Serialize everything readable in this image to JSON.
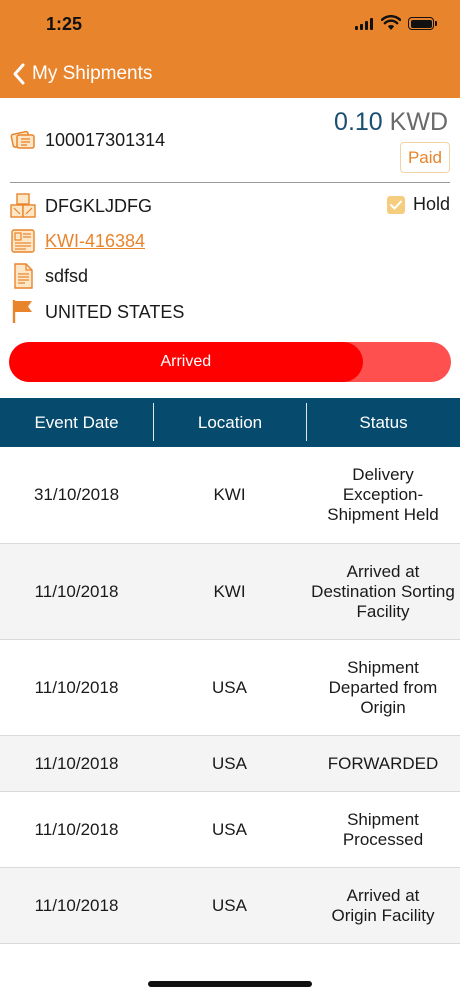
{
  "status_bar": {
    "time": "1:25"
  },
  "nav": {
    "back_label": "My Shipments"
  },
  "shipment": {
    "awb": "100017301314",
    "amount_value": "0.10",
    "amount_currency": "KWD",
    "payment_status": "Paid",
    "reference": "DFGKLJDFG",
    "hold_label": "Hold",
    "hold_checked": true,
    "invoice_link": "KWI-416384",
    "description": "sdfsd",
    "country": "UNITED STATES"
  },
  "progress": {
    "label": "Arrived",
    "fraction": 0.8
  },
  "tracking": {
    "columns": [
      "Event Date",
      "Location",
      "Status"
    ],
    "rows": [
      {
        "date": "31/10/2018",
        "location": "KWI",
        "status": "Delivery Exception- Shipment Held"
      },
      {
        "date": "11/10/2018",
        "location": "KWI",
        "status": "Arrived at Destination Sorting Facility"
      },
      {
        "date": "11/10/2018",
        "location": "USA",
        "status": "Shipment Departed from Origin"
      },
      {
        "date": "11/10/2018",
        "location": "USA",
        "status": "FORWARDED"
      },
      {
        "date": "11/10/2018",
        "location": "USA",
        "status": "Shipment Processed"
      },
      {
        "date": "11/10/2018",
        "location": "USA",
        "status": "Arrived at Origin Facility"
      }
    ]
  },
  "colors": {
    "header": "#e8842c",
    "table_header": "#064b6e",
    "progress_fill": "#ff0000",
    "progress_track": "#ff5050",
    "amount": "#1a4f73"
  },
  "icons": [
    "ticket-icon",
    "boxes-icon",
    "invoice-icon",
    "document-icon",
    "flag-icon",
    "chevron-left-icon",
    "checkbox-icon"
  ]
}
